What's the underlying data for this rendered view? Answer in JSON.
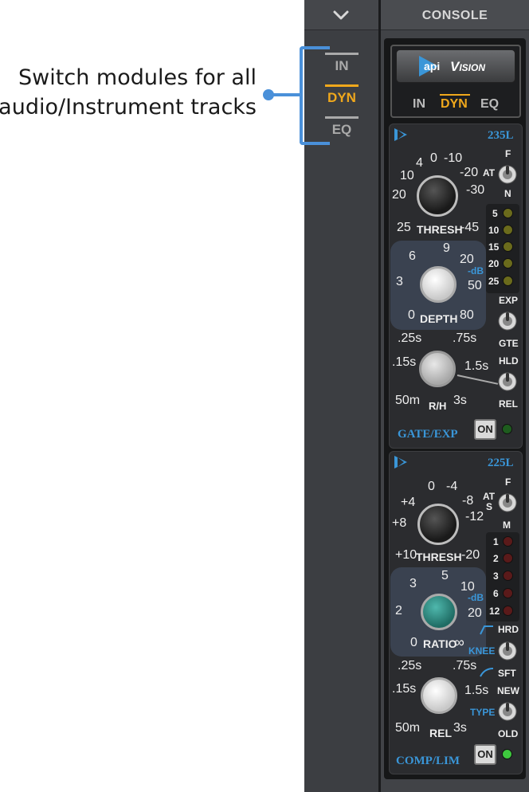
{
  "callout": {
    "line1": "Switch modules for all",
    "line2": "audio/Instrument tracks"
  },
  "left_strip": {
    "collapse_icon": "chevron-down-icon",
    "tabs": [
      "IN",
      "DYN",
      "EQ"
    ],
    "active_tab": "DYN"
  },
  "console": {
    "title": "CONSOLE",
    "badge_logo": "api",
    "badge_text": "Vision",
    "tabs": [
      "IN",
      "DYN",
      "EQ"
    ],
    "active_tab": "DYN"
  },
  "gate": {
    "model": "235L",
    "name": "GATE/EXP",
    "thresh": {
      "label": "THRESH",
      "scale": [
        "4",
        "0",
        "-10",
        "10",
        "-20",
        "-30",
        "20",
        "25",
        "-45"
      ]
    },
    "depth": {
      "label": "DEPTH",
      "unit": "-dB",
      "scale": [
        "6",
        "9",
        "20",
        "3",
        "50",
        "0",
        "80"
      ]
    },
    "rh": {
      "label": "R/H",
      "scale": [
        ".25s",
        ".75s",
        ".15s",
        "1.5s",
        "50m",
        "3s"
      ]
    },
    "toggle1": {
      "top": "F",
      "left": "AT",
      "bottom": "N"
    },
    "toggle2": {
      "top": "EXP",
      "bottom": "GTE"
    },
    "toggle3": {
      "top": "HLD",
      "bottom": "REL"
    },
    "meter": [
      "5",
      "10",
      "15",
      "20",
      "25"
    ],
    "on_label": "ON",
    "colors": {
      "meter_led": "#6b6b1c",
      "status_led": "#1e5c1e"
    }
  },
  "comp": {
    "model": "225L",
    "name": "COMP/LIM",
    "thresh": {
      "label": "THRESH",
      "scale": [
        "0",
        "-4",
        "+4",
        "-8",
        "+8",
        "-12",
        "+10",
        "-20"
      ]
    },
    "ratio": {
      "label": "RATIO",
      "unit": "-dB",
      "scale": [
        "3",
        "5",
        "10",
        "2",
        "20",
        "0",
        "∞"
      ]
    },
    "rel": {
      "label": "REL",
      "scale": [
        ".25s",
        ".75s",
        ".15s",
        "1.5s",
        "50m",
        "3s"
      ]
    },
    "toggle1": {
      "top": "F",
      "left_top": "AT",
      "left_bottom": "S",
      "bottom": "M"
    },
    "knee": {
      "label": "KNEE",
      "top": "HRD",
      "bottom": "SFT"
    },
    "type": {
      "label": "TYPE",
      "top": "NEW",
      "bottom": "OLD"
    },
    "meter": [
      "1",
      "2",
      "3",
      "6",
      "12"
    ],
    "on_label": "ON",
    "colors": {
      "meter_led": "#5a1a1a",
      "status_led": "#3ec83e",
      "ratio_knob": "#2a8a80"
    }
  },
  "colors": {
    "accent_orange": "#f0a81c",
    "accent_blue": "#3a96d8",
    "callout_blue": "#4a90d9"
  }
}
